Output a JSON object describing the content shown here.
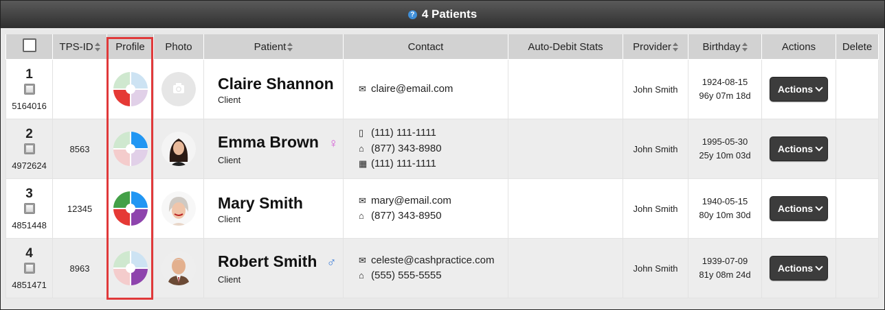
{
  "title": {
    "text": "4 Patients",
    "help_icon": "?"
  },
  "columns": {
    "tps_id": "TPS-ID",
    "profile": "Profile",
    "photo": "Photo",
    "patient": "Patient",
    "contact": "Contact",
    "auto_debit": "Auto-Debit Stats",
    "provider": "Provider",
    "birthday": "Birthday",
    "actions": "Actions",
    "delete": "Delete"
  },
  "patients": [
    {
      "num": "1",
      "cp_id": "5164016",
      "tps_id": "",
      "name": "Claire Shannon",
      "type": "Client",
      "gender": "",
      "contacts": [
        {
          "icon": "email-icon",
          "glyph": "✉",
          "text": "claire@email.com"
        }
      ],
      "provider": "John Smith",
      "birthday": "1924-08-15",
      "age": "96y 07m 18d",
      "action": "Actions",
      "profile_pieces": 1,
      "photo": "placeholder"
    },
    {
      "num": "2",
      "cp_id": "4972624",
      "tps_id": "8563",
      "name": "Emma Brown",
      "type": "Client",
      "gender": "♀",
      "contacts": [
        {
          "icon": "mobile-icon",
          "glyph": "▯",
          "text": "(111) 111-1111"
        },
        {
          "icon": "home-icon",
          "glyph": "⌂",
          "text": "(877) 343-8980"
        },
        {
          "icon": "office-icon",
          "glyph": "▦",
          "text": "(111) 111-1111"
        }
      ],
      "provider": "John Smith",
      "birthday": "1995-05-30",
      "age": "25y 10m 03d",
      "action": "Actions",
      "profile_pieces": 1,
      "photo": "woman"
    },
    {
      "num": "3",
      "cp_id": "4851448",
      "tps_id": "12345",
      "name": "Mary Smith",
      "type": "Client",
      "gender": "",
      "contacts": [
        {
          "icon": "email-icon",
          "glyph": "✉",
          "text": "mary@email.com"
        },
        {
          "icon": "home-icon",
          "glyph": "⌂",
          "text": "(877) 343-8950"
        }
      ],
      "provider": "John Smith",
      "birthday": "1940-05-15",
      "age": "80y 10m 30d",
      "action": "Actions",
      "profile_pieces": 4,
      "photo": "older-woman"
    },
    {
      "num": "4",
      "cp_id": "4851471",
      "tps_id": "8963",
      "name": "Robert Smith",
      "type": "Client",
      "gender": "♂",
      "contacts": [
        {
          "icon": "email-icon",
          "glyph": "✉",
          "text": "celeste@cashpractice.com"
        },
        {
          "icon": "home-icon",
          "glyph": "⌂",
          "text": "(555) 555-5555"
        }
      ],
      "provider": "John Smith",
      "birthday": "1939-07-09",
      "age": "81y 08m 24d",
      "action": "Actions",
      "profile_pieces": 1,
      "photo": "older-man"
    }
  ],
  "colors": {
    "highlight": "#e0393a",
    "action_button": "#3c3c3c",
    "female": "#d45bd6",
    "male": "#3d7ed8",
    "puzzle_red": "#e53935",
    "puzzle_blue": "#2196f3",
    "puzzle_green": "#43a047",
    "puzzle_purple": "#8e44ad"
  }
}
